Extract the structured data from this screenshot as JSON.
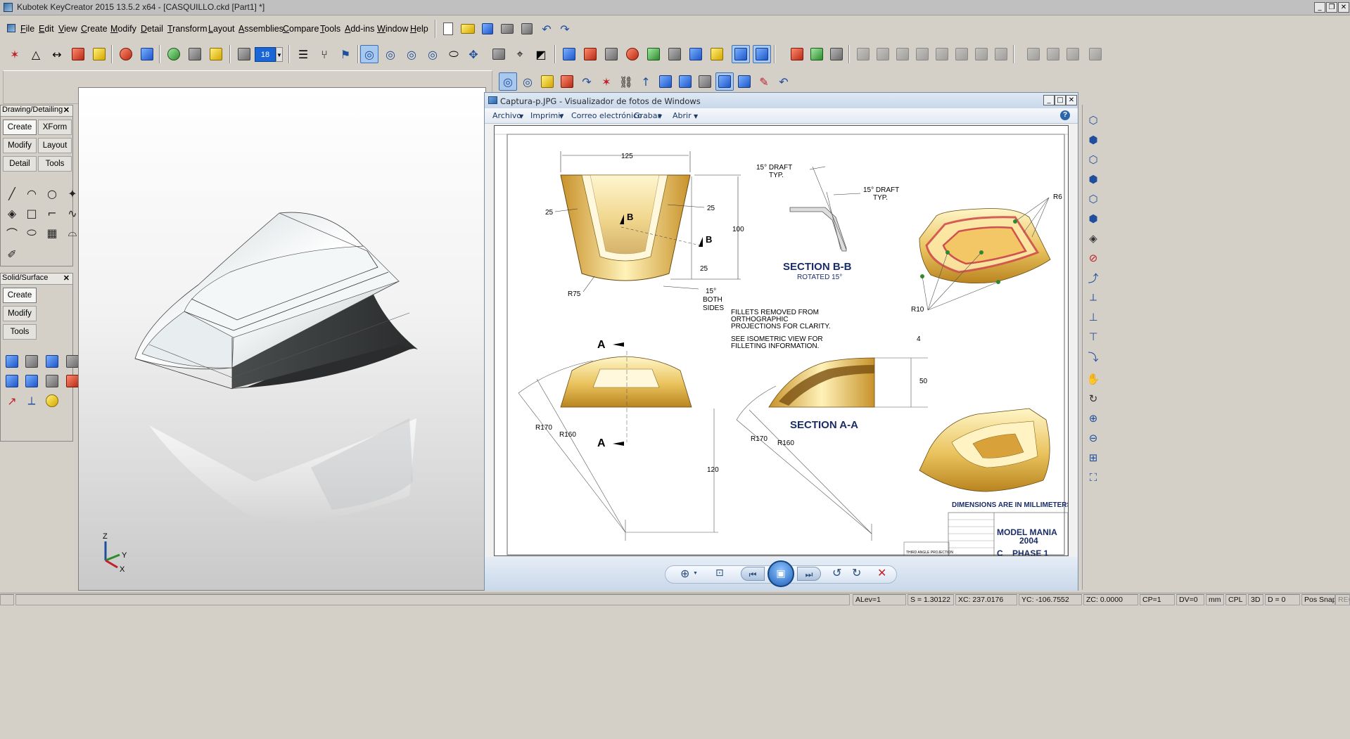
{
  "window": {
    "title": "Kubotek KeyCreator 2015 13.5.2 x64 - [CASQUILLO.ckd [Part1] *]"
  },
  "menu": [
    "File",
    "Edit",
    "View",
    "Create",
    "Modify",
    "Detail",
    "Transform",
    "Layout",
    "Assemblies",
    "Compare",
    "Tools",
    "Add-ins",
    "Window",
    "Help"
  ],
  "toolbar": {
    "layer_value": "18"
  },
  "drawing_panel": {
    "title": "Drawing/Detailing",
    "buttons": [
      "Create",
      "XForm",
      "Modify",
      "Layout",
      "Detail",
      "Tools"
    ]
  },
  "solid_panel": {
    "title": "Solid/Surface",
    "buttons": [
      "Create",
      "Modify",
      "Tools"
    ]
  },
  "axes": {
    "z": "Z",
    "y": "Y",
    "x": "X"
  },
  "photo_viewer": {
    "title": "Captura-p.JPG - Visualizador de fotos de Windows",
    "menu": [
      "Archivo",
      "Imprimir",
      "Correo electrónico",
      "Grabar",
      "Abrir"
    ]
  },
  "drawing_sheet": {
    "dims": [
      "125",
      "25",
      "25",
      "100",
      "25",
      "R75",
      "R170",
      "R160",
      "120",
      "R170",
      "R160",
      "4",
      "50",
      "R6",
      "R10"
    ],
    "labels": {
      "b1": "B",
      "b2": "B",
      "a1": "A",
      "a2": "A",
      "draft1_l1": "15° DRAFT",
      "draft1_l2": "TYP.",
      "draft2_l1": "15° DRAFT",
      "draft2_l2": "TYP.",
      "section_bb": "SECTION B-B",
      "rotated": "ROTATED 15°",
      "both_l1": "15°",
      "both_l2": "BOTH",
      "both_l3": "SIDES",
      "note1_l1": "FILLETS REMOVED FROM",
      "note1_l2": "ORTHOGRAPHIC",
      "note1_l3": "PROJECTIONS FOR CLARITY.",
      "note2_l1": "SEE ISOMETRIC VIEW FOR",
      "note2_l2": "FILLETING INFORMATION.",
      "section_aa": "SECTION A-A",
      "dims_note": "DIMENSIONS ARE IN MILLIMETERS",
      "title_l1": "MODEL MANIA",
      "title_l2": "2004",
      "size": "C",
      "phase": "PHASE 1",
      "projection": "THIRD ANGLE PROJECTION"
    }
  },
  "status": {
    "alev": "ALev=1",
    "scale": "S = 1.30122",
    "xc": "XC: 237.0176",
    "yc": "YC: -106.7552",
    "zc": "ZC: 0.0000",
    "cp": "CP=1",
    "dv": "DV=0",
    "units": "mm",
    "cpl": "CPL",
    "mode": "3D",
    "d": "D = 0",
    "snap": "Pos Snap",
    "rec": "REC"
  }
}
